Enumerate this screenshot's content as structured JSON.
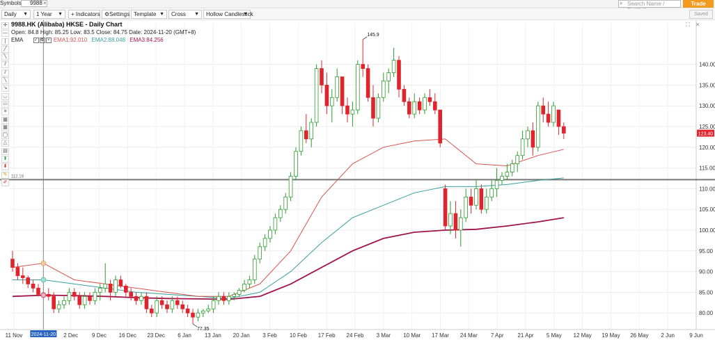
{
  "topbar": {
    "symbols_label": "Symbols:",
    "symbol_value": "9988",
    "search_placeholder": "Search Name / Symbol",
    "trade_label": "Trade"
  },
  "toolbar": {
    "interval": "Daily",
    "range": "1 Year",
    "indicators": "Indicators",
    "settings": "Settings",
    "template": "Template",
    "cursor": "Cross",
    "chart_style": "Hollow Candlestick",
    "saved": "Saved"
  },
  "info": {
    "title": "9988.HK (Alibaba) HKSE - Daily Chart",
    "open_label": "Open:",
    "open": "84.8",
    "high_label": "High:",
    "high": "85.25",
    "low_label": "Low:",
    "low": "83.5",
    "close_label": "Close:",
    "close": "84.75",
    "date_label": "Date:",
    "date": "2024-11-20",
    "tz": "(GMT+8)",
    "ema_label": "EMA",
    "ema1_label": "EMA1:",
    "ema1": "92.010",
    "ema2_label": "EMA2:",
    "ema2": "88.048",
    "ema3_label": "EMA3:",
    "ema3": "84.256"
  },
  "colors": {
    "up": "#2a9d2a",
    "down": "#e0242d",
    "ema1": "#d9534f",
    "ema2": "#3a9e9e",
    "ema3": "#a0144a",
    "hline": "#777777",
    "last_price_bg": "#e0242d"
  },
  "annotations": {
    "high_mark": "145.9",
    "low_mark": "77.35",
    "hline_label": "112.19",
    "last_price": "123.40",
    "cursor_date": "2024-11-20"
  },
  "chart_data": {
    "type": "candlestick",
    "title": "9988.HK (Alibaba) HKSE - Daily Chart",
    "y_ticks": [
      80,
      85,
      90,
      95,
      100,
      105,
      110,
      115,
      120,
      125,
      130,
      135,
      140
    ],
    "ylim": [
      76,
      150
    ],
    "x_ticks": [
      "11 Nov",
      "Nov",
      "2 Dec",
      "9 Dec",
      "16 Dec",
      "23 Dec",
      "6 Jan",
      "13 Jan",
      "20 Jan",
      "3 Feb",
      "10 Feb",
      "17 Feb",
      "24 Feb",
      "3 Mar",
      "10 Mar",
      "17 Mar",
      "24 Mar",
      "7 Apr",
      "21 Apr",
      "5 May",
      "12 May",
      "19 May",
      "26 May",
      "2 Jun",
      "9 Jun"
    ],
    "horizontal_line": 112.19,
    "candles": [
      [
        93,
        95,
        90,
        91
      ],
      [
        91,
        92,
        88,
        89
      ],
      [
        89,
        91,
        87,
        88.5
      ],
      [
        88.5,
        89,
        86,
        87
      ],
      [
        87,
        88,
        85,
        86
      ],
      [
        86,
        87,
        84,
        84.5
      ],
      [
        84.8,
        85.25,
        83.5,
        84.75
      ],
      [
        84.5,
        86,
        83,
        84
      ],
      [
        84,
        85,
        80,
        81
      ],
      [
        81,
        83,
        80,
        82
      ],
      [
        82,
        84,
        81,
        83
      ],
      [
        83,
        86,
        82,
        85
      ],
      [
        85,
        86,
        83,
        84
      ],
      [
        84,
        85,
        81,
        82
      ],
      [
        82,
        85,
        81,
        84
      ],
      [
        84,
        85,
        82,
        83
      ],
      [
        83,
        86,
        82,
        85
      ],
      [
        85,
        87,
        83,
        86
      ],
      [
        86,
        92,
        85,
        87
      ],
      [
        87,
        88,
        83,
        85
      ],
      [
        85,
        89,
        84,
        88
      ],
      [
        88,
        89,
        86,
        86.5
      ],
      [
        86.5,
        87,
        84,
        85
      ],
      [
        85,
        86,
        83,
        84
      ],
      [
        84,
        85,
        82,
        83
      ],
      [
        83,
        85,
        82,
        84
      ],
      [
        84,
        85,
        80,
        81
      ],
      [
        81,
        82,
        79,
        80
      ],
      [
        80,
        84,
        79,
        83
      ],
      [
        83,
        84,
        81,
        82
      ],
      [
        82,
        83,
        80,
        81
      ],
      [
        81,
        84,
        80,
        83
      ],
      [
        83,
        84,
        81,
        82
      ],
      [
        82,
        83,
        80,
        81
      ],
      [
        81,
        82,
        79,
        80
      ],
      [
        80,
        81,
        77.35,
        79
      ],
      [
        79,
        81,
        78,
        80
      ],
      [
        80,
        81,
        79,
        80.5
      ],
      [
        80.5,
        82,
        80,
        81
      ],
      [
        81,
        84,
        80,
        83
      ],
      [
        83,
        85,
        82,
        84
      ],
      [
        84,
        85,
        82,
        83
      ],
      [
        83,
        85,
        82,
        84
      ],
      [
        84,
        85,
        83,
        84.5
      ],
      [
        84.5,
        86,
        84,
        85.5
      ],
      [
        85.5,
        88,
        85,
        87
      ],
      [
        87,
        89,
        86,
        88
      ],
      [
        88,
        94,
        87,
        93
      ],
      [
        93,
        97,
        92,
        96
      ],
      [
        96,
        99,
        95,
        98
      ],
      [
        98,
        101,
        97,
        100
      ],
      [
        100,
        104,
        99,
        103
      ],
      [
        103,
        106,
        102,
        105
      ],
      [
        105,
        109,
        104,
        108
      ],
      [
        108,
        114,
        107,
        113
      ],
      [
        113,
        120,
        112,
        119
      ],
      [
        119,
        125,
        118,
        124
      ],
      [
        124,
        128,
        121,
        122
      ],
      [
        122,
        127,
        120,
        126
      ],
      [
        126,
        140,
        125,
        139
      ],
      [
        139,
        141,
        133,
        135
      ],
      [
        135,
        138,
        128,
        130
      ],
      [
        130,
        134,
        126,
        132
      ],
      [
        132,
        139,
        131,
        137
      ],
      [
        137,
        137,
        128,
        130
      ],
      [
        130,
        132,
        126,
        128
      ],
      [
        128,
        131,
        125,
        129
      ],
      [
        129,
        141,
        128,
        140
      ],
      [
        140,
        146,
        137,
        139
      ],
      [
        139,
        140,
        131,
        132
      ],
      [
        132,
        135,
        125,
        127
      ],
      [
        127,
        133,
        126,
        132
      ],
      [
        132,
        138,
        131,
        136
      ],
      [
        136,
        139,
        133,
        138
      ],
      [
        138,
        144,
        137,
        141
      ],
      [
        141,
        142,
        132,
        134
      ],
      [
        134,
        135,
        130,
        131
      ],
      [
        131,
        132,
        127,
        128
      ],
      [
        128,
        133,
        127,
        131
      ],
      [
        131,
        132,
        128,
        129
      ],
      [
        129,
        133,
        128,
        132
      ],
      [
        132,
        134,
        130,
        131
      ],
      [
        131,
        133,
        128,
        129
      ],
      [
        129,
        122,
        120,
        121
      ],
      [
        110,
        111,
        100,
        101
      ],
      [
        101,
        107,
        99,
        104
      ],
      [
        104,
        107,
        98,
        100
      ],
      [
        100,
        105,
        96,
        103
      ],
      [
        103,
        110,
        102,
        108
      ],
      [
        108,
        110,
        104,
        106
      ],
      [
        106,
        112,
        105,
        110
      ],
      [
        110,
        111,
        104,
        105
      ],
      [
        105,
        110,
        104,
        108
      ],
      [
        108,
        112,
        107,
        110
      ],
      [
        110,
        115,
        108,
        112
      ],
      [
        112,
        114,
        111,
        113
      ],
      [
        113,
        116,
        112,
        114
      ],
      [
        114,
        117,
        113,
        116
      ],
      [
        116,
        119,
        114,
        118
      ],
      [
        118,
        124,
        117,
        122
      ],
      [
        122,
        125,
        120,
        124
      ],
      [
        124,
        126,
        118,
        120
      ],
      [
        120,
        131,
        119,
        130
      ],
      [
        130,
        132,
        126,
        128
      ],
      [
        128,
        131,
        125,
        126
      ],
      [
        126,
        131,
        125,
        130
      ],
      [
        129,
        128,
        123,
        125
      ],
      [
        125,
        126,
        122,
        123.4
      ]
    ],
    "ema1": [
      [
        0,
        91
      ],
      [
        6,
        92
      ],
      [
        12,
        88
      ],
      [
        18,
        87
      ],
      [
        24,
        86
      ],
      [
        30,
        85
      ],
      [
        36,
        84
      ],
      [
        42,
        84
      ],
      [
        48,
        87
      ],
      [
        54,
        95
      ],
      [
        60,
        108
      ],
      [
        66,
        116
      ],
      [
        72,
        120
      ],
      [
        78,
        121.5
      ],
      [
        84,
        122
      ],
      [
        90,
        116
      ],
      [
        96,
        115.5
      ],
      [
        102,
        118
      ],
      [
        107,
        119.5
      ]
    ],
    "ema2": [
      [
        0,
        88
      ],
      [
        6,
        88
      ],
      [
        12,
        87
      ],
      [
        18,
        86
      ],
      [
        24,
        85
      ],
      [
        30,
        84.5
      ],
      [
        36,
        84
      ],
      [
        42,
        83.5
      ],
      [
        48,
        85
      ],
      [
        54,
        90
      ],
      [
        60,
        97
      ],
      [
        66,
        103
      ],
      [
        72,
        106
      ],
      [
        78,
        109
      ],
      [
        84,
        110.5
      ],
      [
        90,
        110.5
      ],
      [
        96,
        111
      ],
      [
        102,
        112
      ],
      [
        107,
        112.6
      ]
    ],
    "ema3": [
      [
        0,
        84
      ],
      [
        6,
        84.3
      ],
      [
        12,
        84.2
      ],
      [
        18,
        84
      ],
      [
        24,
        83.7
      ],
      [
        30,
        83.5
      ],
      [
        36,
        83.4
      ],
      [
        42,
        83.3
      ],
      [
        48,
        84
      ],
      [
        54,
        87
      ],
      [
        60,
        91
      ],
      [
        66,
        95
      ],
      [
        72,
        98
      ],
      [
        78,
        99.5
      ],
      [
        84,
        100
      ],
      [
        90,
        100.2
      ],
      [
        96,
        101
      ],
      [
        102,
        102
      ],
      [
        107,
        103
      ]
    ]
  }
}
